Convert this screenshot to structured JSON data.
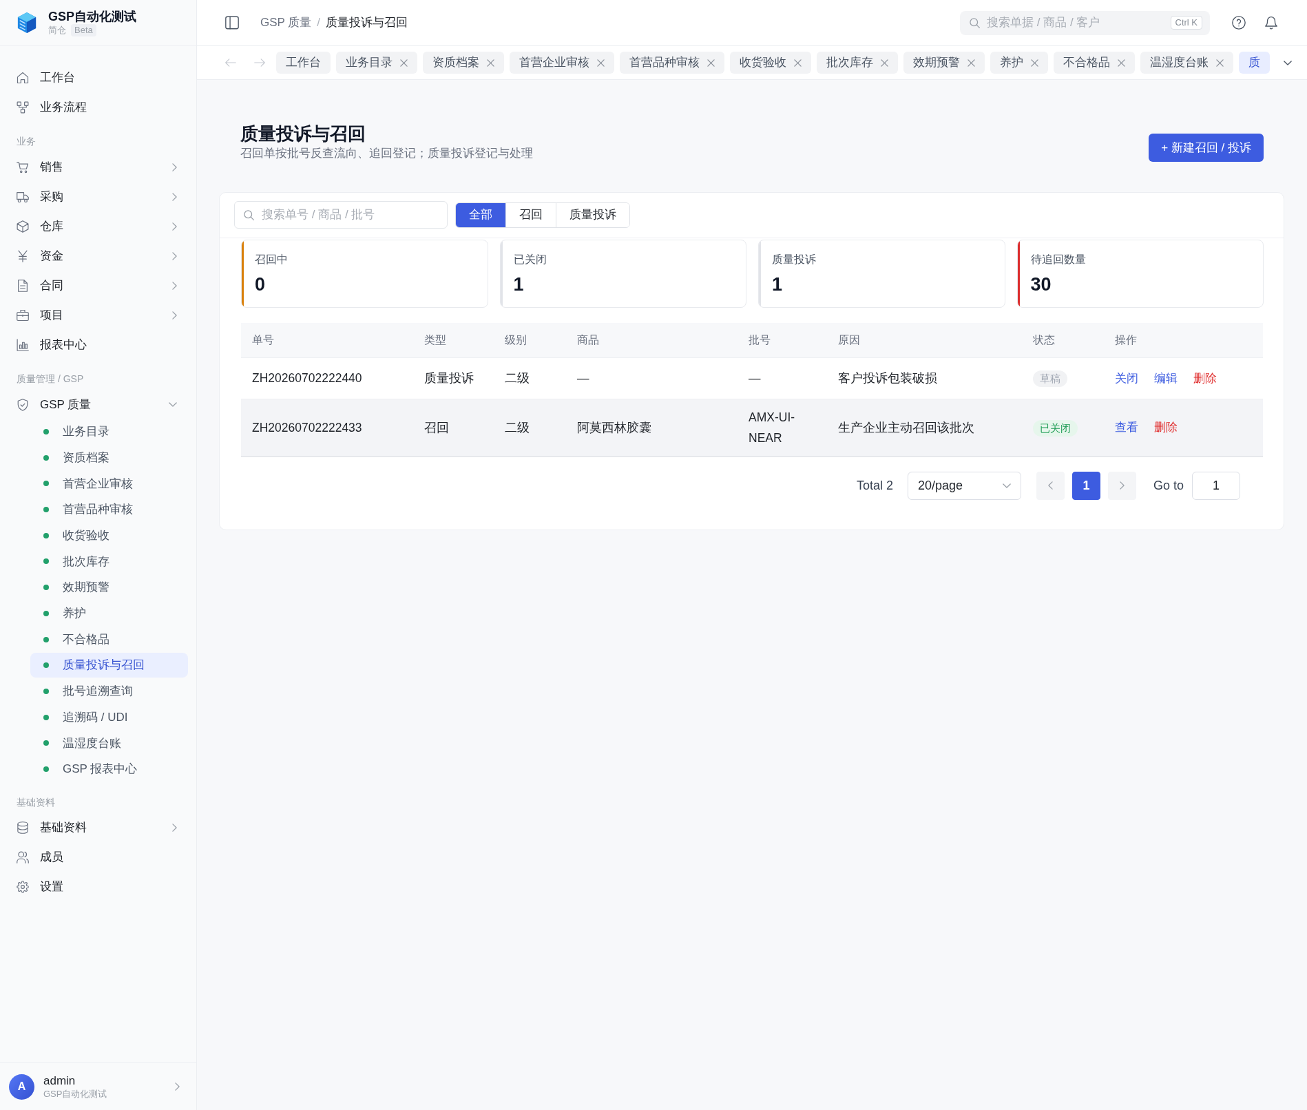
{
  "brand": {
    "title": "GSP自动化测试",
    "subtitle": "简仓",
    "badge": "Beta"
  },
  "sidebar": {
    "sections": [
      {
        "items": [
          {
            "kind": "link",
            "label": "工作台"
          },
          {
            "kind": "link",
            "label": "业务流程"
          }
        ]
      },
      {
        "heading": "业务",
        "items": [
          {
            "kind": "menu",
            "label": "销售",
            "expanded": false
          },
          {
            "kind": "menu",
            "label": "采购",
            "expanded": false
          },
          {
            "kind": "menu",
            "label": "仓库",
            "expanded": false
          },
          {
            "kind": "menu",
            "label": "资金",
            "expanded": false
          },
          {
            "kind": "menu",
            "label": "合同",
            "expanded": false
          },
          {
            "kind": "menu",
            "label": "项目",
            "expanded": false
          },
          {
            "kind": "link",
            "label": "报表中心"
          }
        ]
      },
      {
        "heading": "质量管理 / GSP",
        "items": [
          {
            "kind": "menu",
            "label": "GSP 质量",
            "expanded": true,
            "children": [
              {
                "label": "业务目录",
                "selected": false
              },
              {
                "label": "资质档案",
                "selected": false
              },
              {
                "label": "首营企业审核",
                "selected": false
              },
              {
                "label": "首营品种审核",
                "selected": false
              },
              {
                "label": "收货验收",
                "selected": false
              },
              {
                "label": "批次库存",
                "selected": false
              },
              {
                "label": "效期预警",
                "selected": false
              },
              {
                "label": "养护",
                "selected": false
              },
              {
                "label": "不合格品",
                "selected": false
              },
              {
                "label": "质量投诉与召回",
                "selected": true
              },
              {
                "label": "批号追溯查询",
                "selected": false
              },
              {
                "label": "追溯码 / UDI",
                "selected": false
              },
              {
                "label": "温湿度台账",
                "selected": false
              },
              {
                "label": "GSP 报表中心",
                "selected": false
              }
            ]
          }
        ]
      },
      {
        "heading": "基础资料",
        "items": [
          {
            "kind": "menu",
            "label": "基础资料",
            "expanded": false
          },
          {
            "kind": "link",
            "label": "成员"
          },
          {
            "kind": "link",
            "label": "设置"
          }
        ]
      }
    ]
  },
  "user": {
    "initial": "A",
    "name": "admin",
    "org": "GSP自动化测试"
  },
  "topbar": {
    "breadcrumb": [
      "GSP 质量",
      "质量投诉与召回"
    ],
    "breadcrumb_separator": "/",
    "search": {
      "placeholder": "搜索单据 / 商品 / 客户",
      "shortcut": "Ctrl K"
    }
  },
  "tab_nav": {
    "back_disabled": true,
    "forward_disabled": true
  },
  "tabs": [
    {
      "label": "工作台",
      "closable": false,
      "selected": false
    },
    {
      "label": "业务目录",
      "closable": true,
      "selected": false
    },
    {
      "label": "资质档案",
      "closable": true,
      "selected": false
    },
    {
      "label": "首营企业审核",
      "closable": true,
      "selected": false
    },
    {
      "label": "首营品种审核",
      "closable": true,
      "selected": false
    },
    {
      "label": "收货验收",
      "closable": true,
      "selected": false
    },
    {
      "label": "批次库存",
      "closable": true,
      "selected": false
    },
    {
      "label": "效期预警",
      "closable": true,
      "selected": false
    },
    {
      "label": "养护",
      "closable": true,
      "selected": false
    },
    {
      "label": "不合格品",
      "closable": true,
      "selected": false
    },
    {
      "label": "温湿度台账",
      "closable": true,
      "selected": false
    },
    {
      "label": "质",
      "closable": false,
      "selected": true
    }
  ],
  "page": {
    "title": "质量投诉与召回",
    "subtitle": "召回单按批号反查流向、追回登记；质量投诉登记与处理",
    "new_button": "+ 新建召回 / 投诉"
  },
  "filter": {
    "search": {
      "placeholder": "搜索单号 / 商品 / 批号"
    },
    "segments": [
      {
        "label": "全部",
        "selected": true
      },
      {
        "label": "召回",
        "selected": false
      },
      {
        "label": "质量投诉",
        "selected": false
      }
    ]
  },
  "stats": [
    {
      "label": "召回中",
      "value": "0",
      "color": "#d9800b"
    },
    {
      "label": "已关闭",
      "value": "1",
      "color": "#e1e3e8"
    },
    {
      "label": "质量投诉",
      "value": "1",
      "color": "#e1e3e8"
    },
    {
      "label": "待追回数量",
      "value": "30",
      "color": "#dc2f2f"
    }
  ],
  "table": {
    "columns": [
      "单号",
      "类型",
      "级别",
      "商品",
      "批号",
      "原因",
      "状态",
      "操作"
    ],
    "rows": [
      {
        "cells": [
          "ZH20260702222440",
          "质量投诉",
          "二级",
          "—",
          "—",
          "客户投诉包装破损"
        ],
        "status": {
          "label": "草稿",
          "kind": "draft"
        },
        "actions": [
          {
            "label": "关闭",
            "kind": "link"
          },
          {
            "label": "编辑",
            "kind": "link"
          },
          {
            "label": "删除",
            "kind": "danger"
          }
        ],
        "hovered": false
      },
      {
        "cells": [
          "ZH20260702222433",
          "召回",
          "二级",
          "阿莫西林胶囊",
          "AMX-UI-NEAR",
          "生产企业主动召回该批次"
        ],
        "status": {
          "label": "已关闭",
          "kind": "closed"
        },
        "actions": [
          {
            "label": "查看",
            "kind": "link"
          },
          {
            "label": "删除",
            "kind": "danger"
          }
        ],
        "hovered": true
      }
    ]
  },
  "pagination": {
    "total": "Total 2",
    "page_size": "20/page",
    "prev_disabled": true,
    "pages": [
      {
        "label": "1",
        "selected": true
      }
    ],
    "next_disabled": true,
    "goto_label": "Go to",
    "goto_value": "1"
  }
}
